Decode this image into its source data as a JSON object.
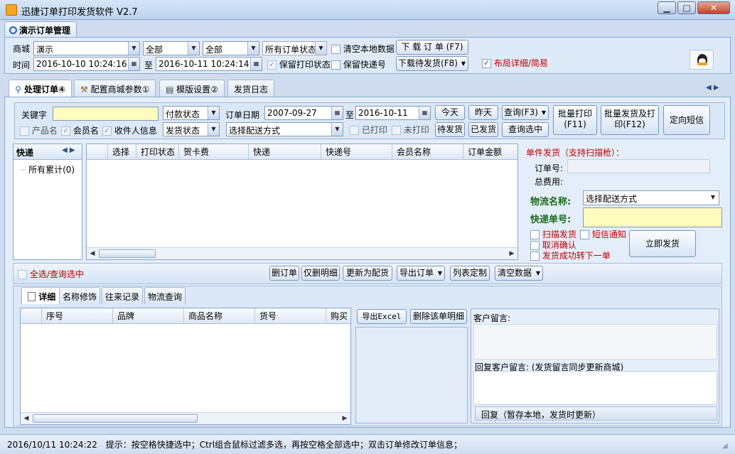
{
  "window": {
    "title": "迅捷订单打印发货软件 V2.7",
    "min": "▁",
    "max": "□",
    "close": "✕"
  },
  "section_title": "演示订单管理",
  "top": {
    "mall_label": "商城",
    "mall_value": "演示",
    "sel_all_1": "全部",
    "sel_all_2": "全部",
    "order_status": "所有订单状态",
    "clear_local": "清空本地数据",
    "download_order": "下 载 订 单 (F7)",
    "time_label": "时间",
    "time_from": "2016-10-10 10:24:16",
    "to": "至",
    "time_to": "2016-10-11 10:24:14",
    "keep_print": "保留打印状态",
    "keep_express": "保留快递号",
    "download_pending": "下载待发货(F8)",
    "layout": "布局详细/简易"
  },
  "tabs": [
    "处理订单④",
    "配置商城参数①",
    "模版设置②",
    "发货日志"
  ],
  "filter": {
    "keyword_label": "关键字",
    "pay_status": "付款状态",
    "order_date_label": "订单日期",
    "date_from": "2007-09-27",
    "to": "至",
    "date_to": "2016-10-11",
    "today": "今天",
    "yesterday": "昨天",
    "query": "查询(F3)",
    "batch_print": "批量打印\n(F11)",
    "batch_ship": "批量发货及打\n印(F12)",
    "sms": "定向短信",
    "product_name": "产品名",
    "member_name": "会员名",
    "receiver_info": "收件人信息",
    "ship_status": "发货状态",
    "ship_method": "选择配送方式",
    "printed": "已打印",
    "unprinted": "未打印",
    "pending_ship": "待发货",
    "shipped": "已发货",
    "query_selected": "查询选中"
  },
  "express_panel": {
    "title": "快递",
    "item": "所有累计(0)"
  },
  "order_grid": {
    "columns": [
      "选择",
      "打印状态",
      "贺卡费",
      "快递",
      "快递号",
      "会员名称",
      "订单金额"
    ]
  },
  "single_ship": {
    "title": "单件发货（支持扫描枪）：",
    "order_no": "订单号:",
    "total_fee": "总费用:",
    "logistics_label": "物流名称:",
    "logistics_value": "选择配送方式",
    "tracking_label": "快递单号:",
    "scan_ship": "扫描发货",
    "sms_notify": "短信通知",
    "cancel_confirm": "取消确认",
    "next_after_ship": "发货成功转下一单",
    "ship_now": "立即发货"
  },
  "actions": {
    "select_all": "全选/查询选中",
    "delete_order": "删订单",
    "delete_detail_only": "仅删明细",
    "update_to_ship": "更新为配货",
    "export_order": "导出订单",
    "list_custom": "列表定制",
    "clear_data": "清空数据"
  },
  "detail_tabs": [
    "详细",
    "名称修饰",
    "往来记录",
    "物流查询"
  ],
  "detail_grid": {
    "columns": [
      "序号",
      "品牌",
      "商品名称",
      "货号",
      "购买"
    ]
  },
  "detail_buttons": {
    "export_excel": "导出Excel",
    "delete_detail": "删除该单明细"
  },
  "customer": {
    "message_label": "客户留言:",
    "reply_label": "回复客户留言: (发货留言同步更新商城)",
    "reply_bottom": "回复（暂存本地，发货时更新）"
  },
  "status": {
    "time": "2016/10/11 10:24:22",
    "hint": "提示：按空格快捷选中；Ctrl组合鼠标过滤多选，再按空格全部选中；双击订单修改订单信息；"
  },
  "colors": {
    "accent_red": "#c00000",
    "logistics_green": "#1a6b1a",
    "tracking_yellow": "#fffcc0"
  }
}
